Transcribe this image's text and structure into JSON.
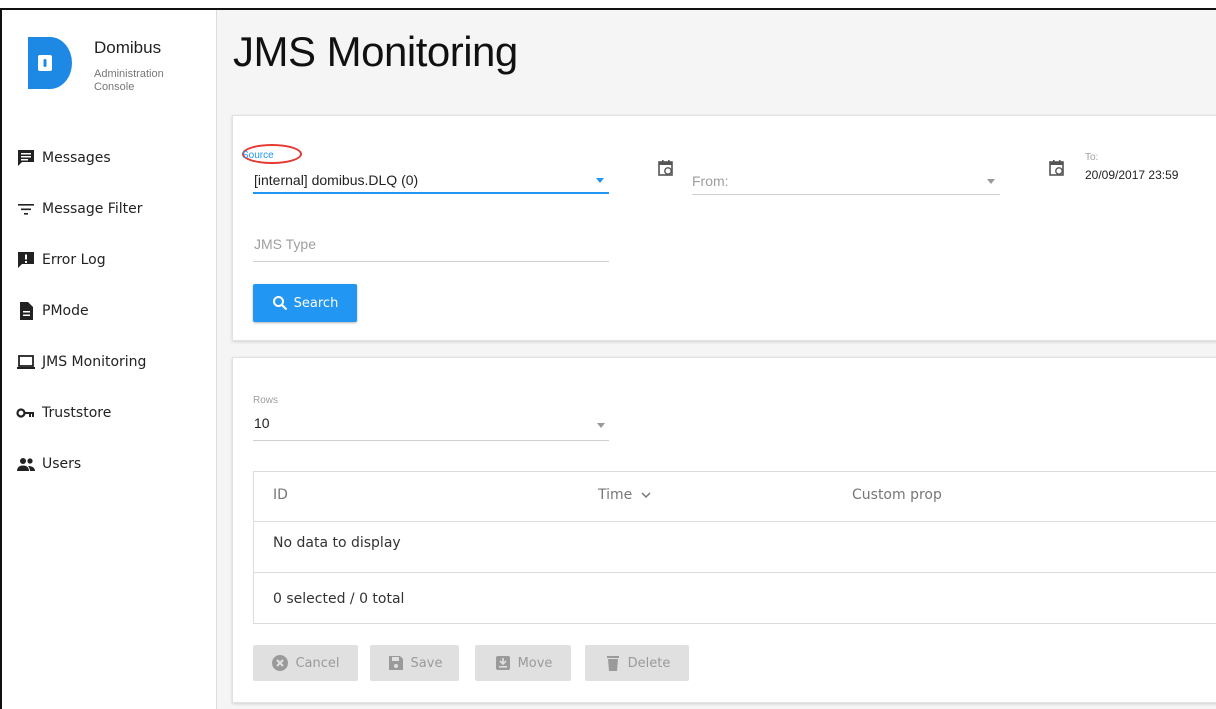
{
  "brand": {
    "name": "Domibus",
    "subtitle": "Administration Console"
  },
  "sidebar": {
    "items": [
      {
        "label": "Messages",
        "icon": "messages-icon"
      },
      {
        "label": "Message Filter",
        "icon": "filter-icon"
      },
      {
        "label": "Error Log",
        "icon": "error-log-icon"
      },
      {
        "label": "PMode",
        "icon": "document-icon"
      },
      {
        "label": "JMS Monitoring",
        "icon": "laptop-icon"
      },
      {
        "label": "Truststore",
        "icon": "key-icon"
      },
      {
        "label": "Users",
        "icon": "users-icon"
      }
    ]
  },
  "page": {
    "title": "JMS Monitoring"
  },
  "filters": {
    "source_label": "Source",
    "source_value": "[internal] domibus.DLQ (0)",
    "from_placeholder": "From:",
    "to_label": "To:",
    "to_value": "20/09/2017 23:59",
    "jms_type_placeholder": "JMS Type",
    "search_label": "Search"
  },
  "results": {
    "rows_label": "Rows",
    "rows_value": "10",
    "columns": [
      "ID",
      "Time",
      "Custom prop"
    ],
    "empty_message": "No data to display",
    "footer": "0 selected / 0 total"
  },
  "actions": {
    "cancel": "Cancel",
    "save": "Save",
    "move": "Move",
    "delete": "Delete"
  },
  "colors": {
    "accent": "#2196f3",
    "annotation": "#e53935",
    "logo": "#1e88e5"
  }
}
